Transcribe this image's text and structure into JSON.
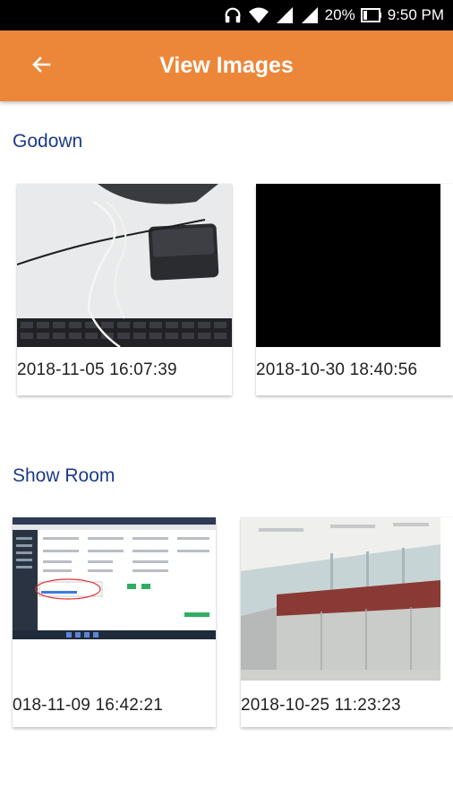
{
  "status_bar": {
    "battery": "20%",
    "time": "9:50 PM",
    "icons": [
      "headphones-icon",
      "wifi-icon",
      "signal-icon",
      "signal-icon",
      "battery-icon"
    ]
  },
  "app_bar": {
    "title": "View Images",
    "back_icon": "arrow-left-icon",
    "color": "#ec873a"
  },
  "sections": [
    {
      "title": "Godown",
      "images": [
        {
          "timestamp": "2018-11-05 16:07:39"
        },
        {
          "timestamp": "2018-10-30 18:40:56"
        }
      ]
    },
    {
      "title": "Show Room",
      "images": [
        {
          "timestamp": "018-11-09 16:42:21"
        },
        {
          "timestamp": "2018-10-25 11:23:23"
        }
      ]
    }
  ]
}
